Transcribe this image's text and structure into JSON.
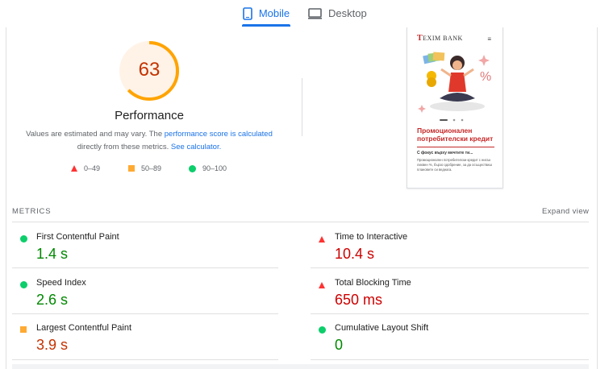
{
  "tabs": {
    "mobile_label": "Mobile",
    "desktop_label": "Desktop"
  },
  "performance": {
    "score": "63",
    "score_fraction": 0.63,
    "title": "Performance",
    "desc_part1": "Values are estimated and may vary. The ",
    "desc_link1": "performance score is calculated",
    "desc_part2": " directly from these metrics. ",
    "desc_link2": "See calculator."
  },
  "legend": {
    "fail": "0–49",
    "average": "50–89",
    "pass": "90–100"
  },
  "phone_preview": {
    "logo_t": "T",
    "logo_rest": "EXIM BANK",
    "menu_icon": "≡",
    "headline": "Промоционален потребителски кредит",
    "subheading": "С фокус върху мечтите ти...",
    "body": "Промоционален потребителски кредит с нисък лихвен %, бързо одобрение, за да осъществиш плановете си веднага."
  },
  "metrics": {
    "label": "METRICS",
    "expand_label": "Expand view",
    "items": [
      {
        "name": "First Contentful Paint",
        "value": "1.4 s",
        "status": "pass",
        "icon": "circle-icon"
      },
      {
        "name": "Time to Interactive",
        "value": "10.4 s",
        "status": "fail",
        "icon": "triangle-icon"
      },
      {
        "name": "Speed Index",
        "value": "2.6 s",
        "status": "pass",
        "icon": "circle-icon"
      },
      {
        "name": "Total Blocking Time",
        "value": "650 ms",
        "status": "fail",
        "icon": "triangle-icon"
      },
      {
        "name": "Largest Contentful Paint",
        "value": "3.9 s",
        "status": "average",
        "icon": "square-icon"
      },
      {
        "name": "Cumulative Layout Shift",
        "value": "0",
        "status": "pass",
        "icon": "circle-icon"
      }
    ]
  },
  "colors": {
    "accent": "#1a73e8",
    "pass": "#0cce6b",
    "average": "#ffa400",
    "fail": "#ff3333",
    "pass_text": "#008800",
    "average_text": "#c33300",
    "fail_text": "#cc0000"
  }
}
